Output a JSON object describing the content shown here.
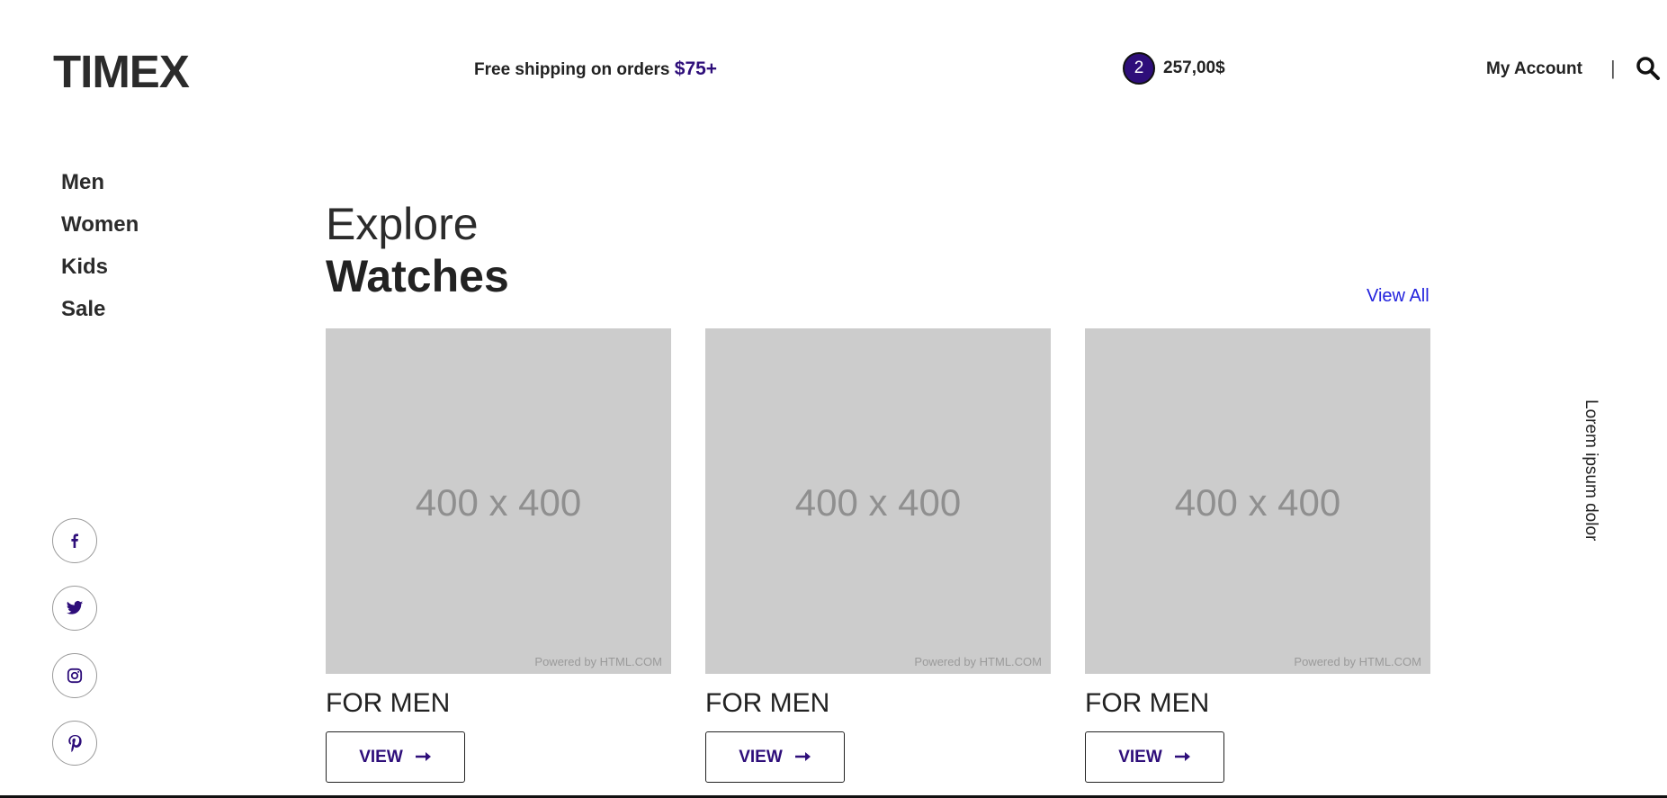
{
  "header": {
    "logo": "TIMEX",
    "shipping_text": "Free shipping on orders",
    "shipping_amount": "$75+",
    "cart_count": "2",
    "cart_total": "257,00$",
    "account_label": "My Account",
    "separator": "|",
    "search_icon": "search-icon"
  },
  "sidebar": {
    "items": [
      {
        "label": "Men"
      },
      {
        "label": "Women"
      },
      {
        "label": "Kids"
      },
      {
        "label": "Sale"
      }
    ],
    "socials": [
      "facebook-icon",
      "twitter-icon",
      "instagram-icon",
      "pinterest-icon"
    ]
  },
  "main": {
    "heading_light": "Explore",
    "heading_bold": "Watches",
    "view_all": "View All",
    "cards": [
      {
        "image_text": "400 x 400",
        "powered": "Powered by HTML.COM",
        "title": "FOR MEN",
        "button": "VIEW"
      },
      {
        "image_text": "400 x 400",
        "powered": "Powered by HTML.COM",
        "title": "FOR MEN",
        "button": "VIEW"
      },
      {
        "image_text": "400 x 400",
        "powered": "Powered by HTML.COM",
        "title": "FOR MEN",
        "button": "VIEW"
      }
    ]
  },
  "side_text": "Lorem ipsum dolor",
  "colors": {
    "accent": "#2e0e7a",
    "link": "#2222dd",
    "placeholder": "#cccccc"
  }
}
